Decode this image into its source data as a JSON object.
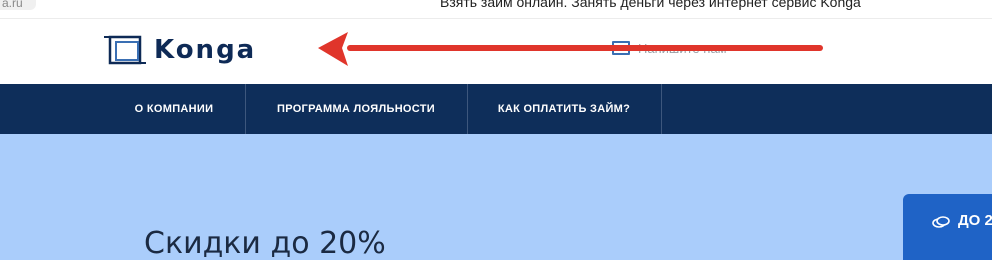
{
  "browser": {
    "url_fragment": "a.ru",
    "page_title": "Взять займ онлайн. Занять деньги через интернет сервис Konga"
  },
  "header": {
    "logo_text": "Konga",
    "logo_icon": "konga-square-logo",
    "contact_label": "Напишите нам",
    "contact_icon": "mail-icon"
  },
  "nav": {
    "items": [
      {
        "label": "О КОМПАНИИ"
      },
      {
        "label": "ПРОГРАММА ЛОЯЛЬНОСТИ"
      },
      {
        "label": "КАК ОПЛАТИТЬ ЗАЙМ?"
      }
    ]
  },
  "hero": {
    "title": "Скидки до 20%"
  },
  "side_button": {
    "label": "ДО 2",
    "icon": "coins-icon"
  },
  "annotation": {
    "arrow_color": "#e0352b"
  },
  "colors": {
    "nav_bg": "#0e2e5a",
    "hero_bg": "#aacdfb",
    "brand": "#0e2a56",
    "side_button_bg": "#1f63c6"
  }
}
